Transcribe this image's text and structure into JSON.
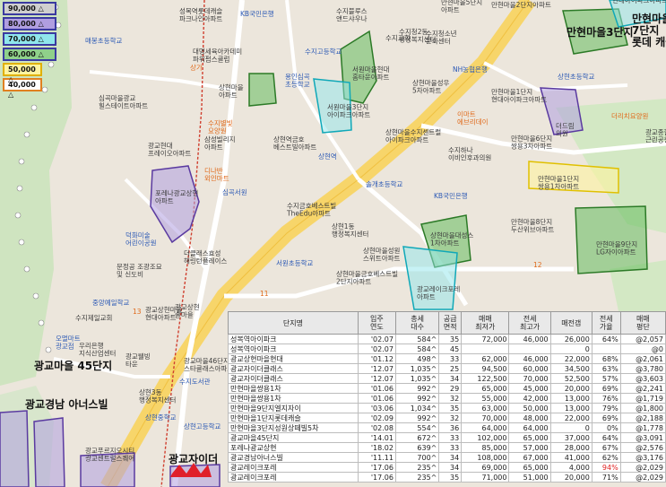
{
  "legend": [
    {
      "label": "90,000 △",
      "color": "#cfcfcf",
      "border": "#3a3aa0"
    },
    {
      "label": "80,000 △",
      "color": "#b09ee0",
      "border": "#3a3aa0"
    },
    {
      "label": "70,000 △",
      "color": "#8fe6ec",
      "border": "#3a3aa0"
    },
    {
      "label": "60,000 △",
      "color": "#8fd08a",
      "border": "#3a3aa0"
    },
    {
      "label": "50,000 △",
      "color": "#fff4a0",
      "border": "#e0b000"
    },
    {
      "label": "40,000 △",
      "color": "#ffffff",
      "border": "#e08020"
    }
  ],
  "map_labels": {
    "sungbok_park": "성복역롯데캐슬\n파크나인아파트",
    "kb_bank_top": "KB국민은행",
    "suji_stream": "수지블루스\n앤드샤우나",
    "manhyun_5_top": "만현마을5단지\n아파트",
    "manhyun_2_top": "만현마을2단지아파트",
    "manhyun_7_title": "만현마을\n7단지\n롯데 캐슬",
    "manhyun_3_line": "현대아이파크아파트",
    "yebong_school": "매봉초등학교",
    "samga": "상가",
    "daemyung": "대명세육아카데미\n파워펌스클럽",
    "yongin_suji": "용인심곡\n초등학교",
    "suji_church": "수지교회",
    "hyundai_elevator": "서원마을현대\n홈타운아파트",
    "suji_high": "수지고등학교",
    "suji_district": "수지청2동\n행정복지센터",
    "suji_youth": "수지청소년\n문화센터",
    "nh": "NH농협은행",
    "sungbok_yu": "상현초등학교",
    "simgok_hill": "심곡마을광교\n힐스테이트아파트",
    "sungdong_pk": "상현마을\n아파트",
    "suji_hospital": "수지별빛\n요양원",
    "seowon_3": "서원마을3단지\n아이파크아파트",
    "sunghyun_5": "상현마을성우\n5차아파트",
    "manhyun_1": "만현마을1단지\n현대아이파크아파트",
    "emart": "이마트\n에브리데이",
    "sunghyun_doctor": "더리치요양원",
    "gwanggyo_hyundai": "광교현대\n프레이오아파트",
    "samsung_villa": "삼성빌리지\n아파트",
    "sungbok_geumho": "상현역금호\n베스트빌아파트",
    "sunghyun_2_center": "상현마을수지센트럴\n아이파크아파트",
    "sujihana": "수지하나\n이비인후과의원",
    "manhyun_6": "만현마을6단지\n쌍용3차아파트",
    "dream_center": "더드림\n의원",
    "dona": "디나반\n외인마트",
    "sungdong_park_label": "포레나광교상현\n아파트",
    "simgok_seowon": "심곡서원",
    "manhyun_1_sunyoung": "만현마을1단지\n쌍용1차아파트",
    "gwanggyo_5_label": "광교종합\n근린공원",
    "sungkul": "상현역",
    "chulsung": "솔개초등학교",
    "kb_bank": "KB국민은행",
    "sunghyun_1_label": "상현1동\n행정복지센터",
    "manhyun_8": "만현마을8단지\n두산위브아파트",
    "manhyun_9": "만현마을9단지\nLG자이아파트",
    "deokhwa": "덕화미술\n어린이공원",
    "gumgyo": "수지금호베스트빌\nTheEdu아파트",
    "sunghyun_doam": "상현마을대성스\n1차아파트",
    "munjung": "문정공 조광조묘\n및 신도비",
    "gwanggyo_centum": "더클래스효성\n해링턴플레이스",
    "sunghyun_sk": "상현마을성원\n스위트아파트",
    "sunghyun_geum": "상현마을금호베스트빌\n2단지아파트",
    "sungwon_school": "서원초등학교",
    "gwanggyo_lake": "광교레이크포레\n아파트",
    "jungang_school": "중앙예일학교",
    "suji_3rd": "수지제일교회",
    "gwanggyo_sangsung": "광교상현마을\n현대아파트",
    "gwanggyo_dong": "광교상현\n솔마을",
    "omart": "오멀마트\n광교점",
    "gwanggyo_46": "광교마을46단지\n스타클래스아파트",
    "gwanggyo_46_2": "광교웰빙\n타운",
    "wooribank": "우리은행\n지식산업센터",
    "sangchun": "상현3동\n행정복지센터",
    "suji_dosegwan": "수지도서관",
    "gwanggyo_45_title": "광교마을 45단지",
    "gwanggyo_nam_title": "광교경남 아너스빌",
    "gwanggyo_ucl": "광교푸르지오시티\n광교센트럴스퀘어",
    "sunghyun_high": "상현고등학교",
    "gwanggyo_xi_title": "광교자이더",
    "sangmyung_school": "상현중학교",
    "manhyun_3_title": "만현마을3단지",
    "jeon_12": "12",
    "jeon_11": "11",
    "jeon_13": "13"
  },
  "table": {
    "headers": [
      "단지명",
      "입주\n연도",
      "총세\n대수",
      "공급\n면적",
      "매매\n최저가",
      "전세\n최고가",
      "매전갭",
      "전세\n가율",
      "매매\n평단"
    ],
    "rows": [
      [
        "성복역아이파크",
        "'02.07",
        "584^",
        "35",
        "72,000",
        "46,000",
        "26,000",
        "64%",
        "@2,057"
      ],
      [
        "성복역아이파크",
        "'02.07",
        "584^",
        "45",
        "",
        "",
        "0",
        "",
        "@0"
      ],
      [
        "광교상현마을현대",
        "'01.12",
        "498^",
        "33",
        "62,000",
        "46,000",
        "22,000",
        "68%",
        "@2,061"
      ],
      [
        "광교자이더클래스",
        "'12.07",
        "1,035^",
        "25",
        "94,500",
        "60,000",
        "34,500",
        "63%",
        "@3,780"
      ],
      [
        "광교자이더클래스",
        "'12.07",
        "1,035^",
        "34",
        "122,500",
        "70,000",
        "52,500",
        "57%",
        "@3,603"
      ],
      [
        "만현마을쌍용1차",
        "'01.06",
        "992^",
        "29",
        "65,000",
        "45,000",
        "20,000",
        "69%",
        "@2,241"
      ],
      [
        "만현마을쌍용1차",
        "'01.06",
        "992^",
        "32",
        "55,000",
        "42,000",
        "13,000",
        "76%",
        "@1,719"
      ],
      [
        "만현마을9단지엘지자이",
        "'03.06",
        "1,034^",
        "35",
        "63,000",
        "50,000",
        "13,000",
        "79%",
        "@1,800"
      ],
      [
        "만현마을1단지롯데캐슬",
        "'02.09",
        "992^",
        "32",
        "70,000",
        "48,000",
        "22,000",
        "69%",
        "@2,188"
      ],
      [
        "만현마을3단지성원상떼빌5차",
        "'02.08",
        "554^",
        "36",
        "64,000",
        "64,000",
        "0",
        "0%",
        "@1,778"
      ],
      [
        "광교마을45단지",
        "'14.01",
        "672^",
        "33",
        "102,000",
        "65,000",
        "37,000",
        "64%",
        "@3,091"
      ],
      [
        "포레나광교상현",
        "'18.02",
        "639^",
        "33",
        "85,000",
        "57,000",
        "28,000",
        "67%",
        "@2,576"
      ],
      [
        "광교경남아너스빌",
        "'11.11",
        "700^",
        "34",
        "108,000",
        "67,000",
        "41,000",
        "62%",
        "@3,176"
      ],
      [
        "광교레이크포레",
        "'17.06",
        "235^",
        "34",
        "69,000",
        "65,000",
        "4,000",
        "94%",
        "@2,029"
      ],
      [
        "광교레이크포레",
        "'17.06",
        "235^",
        "35",
        "71,000",
        "51,000",
        "20,000",
        "71%",
        "@2,029"
      ]
    ],
    "highlight_row": 13,
    "highlight_col": 7
  }
}
